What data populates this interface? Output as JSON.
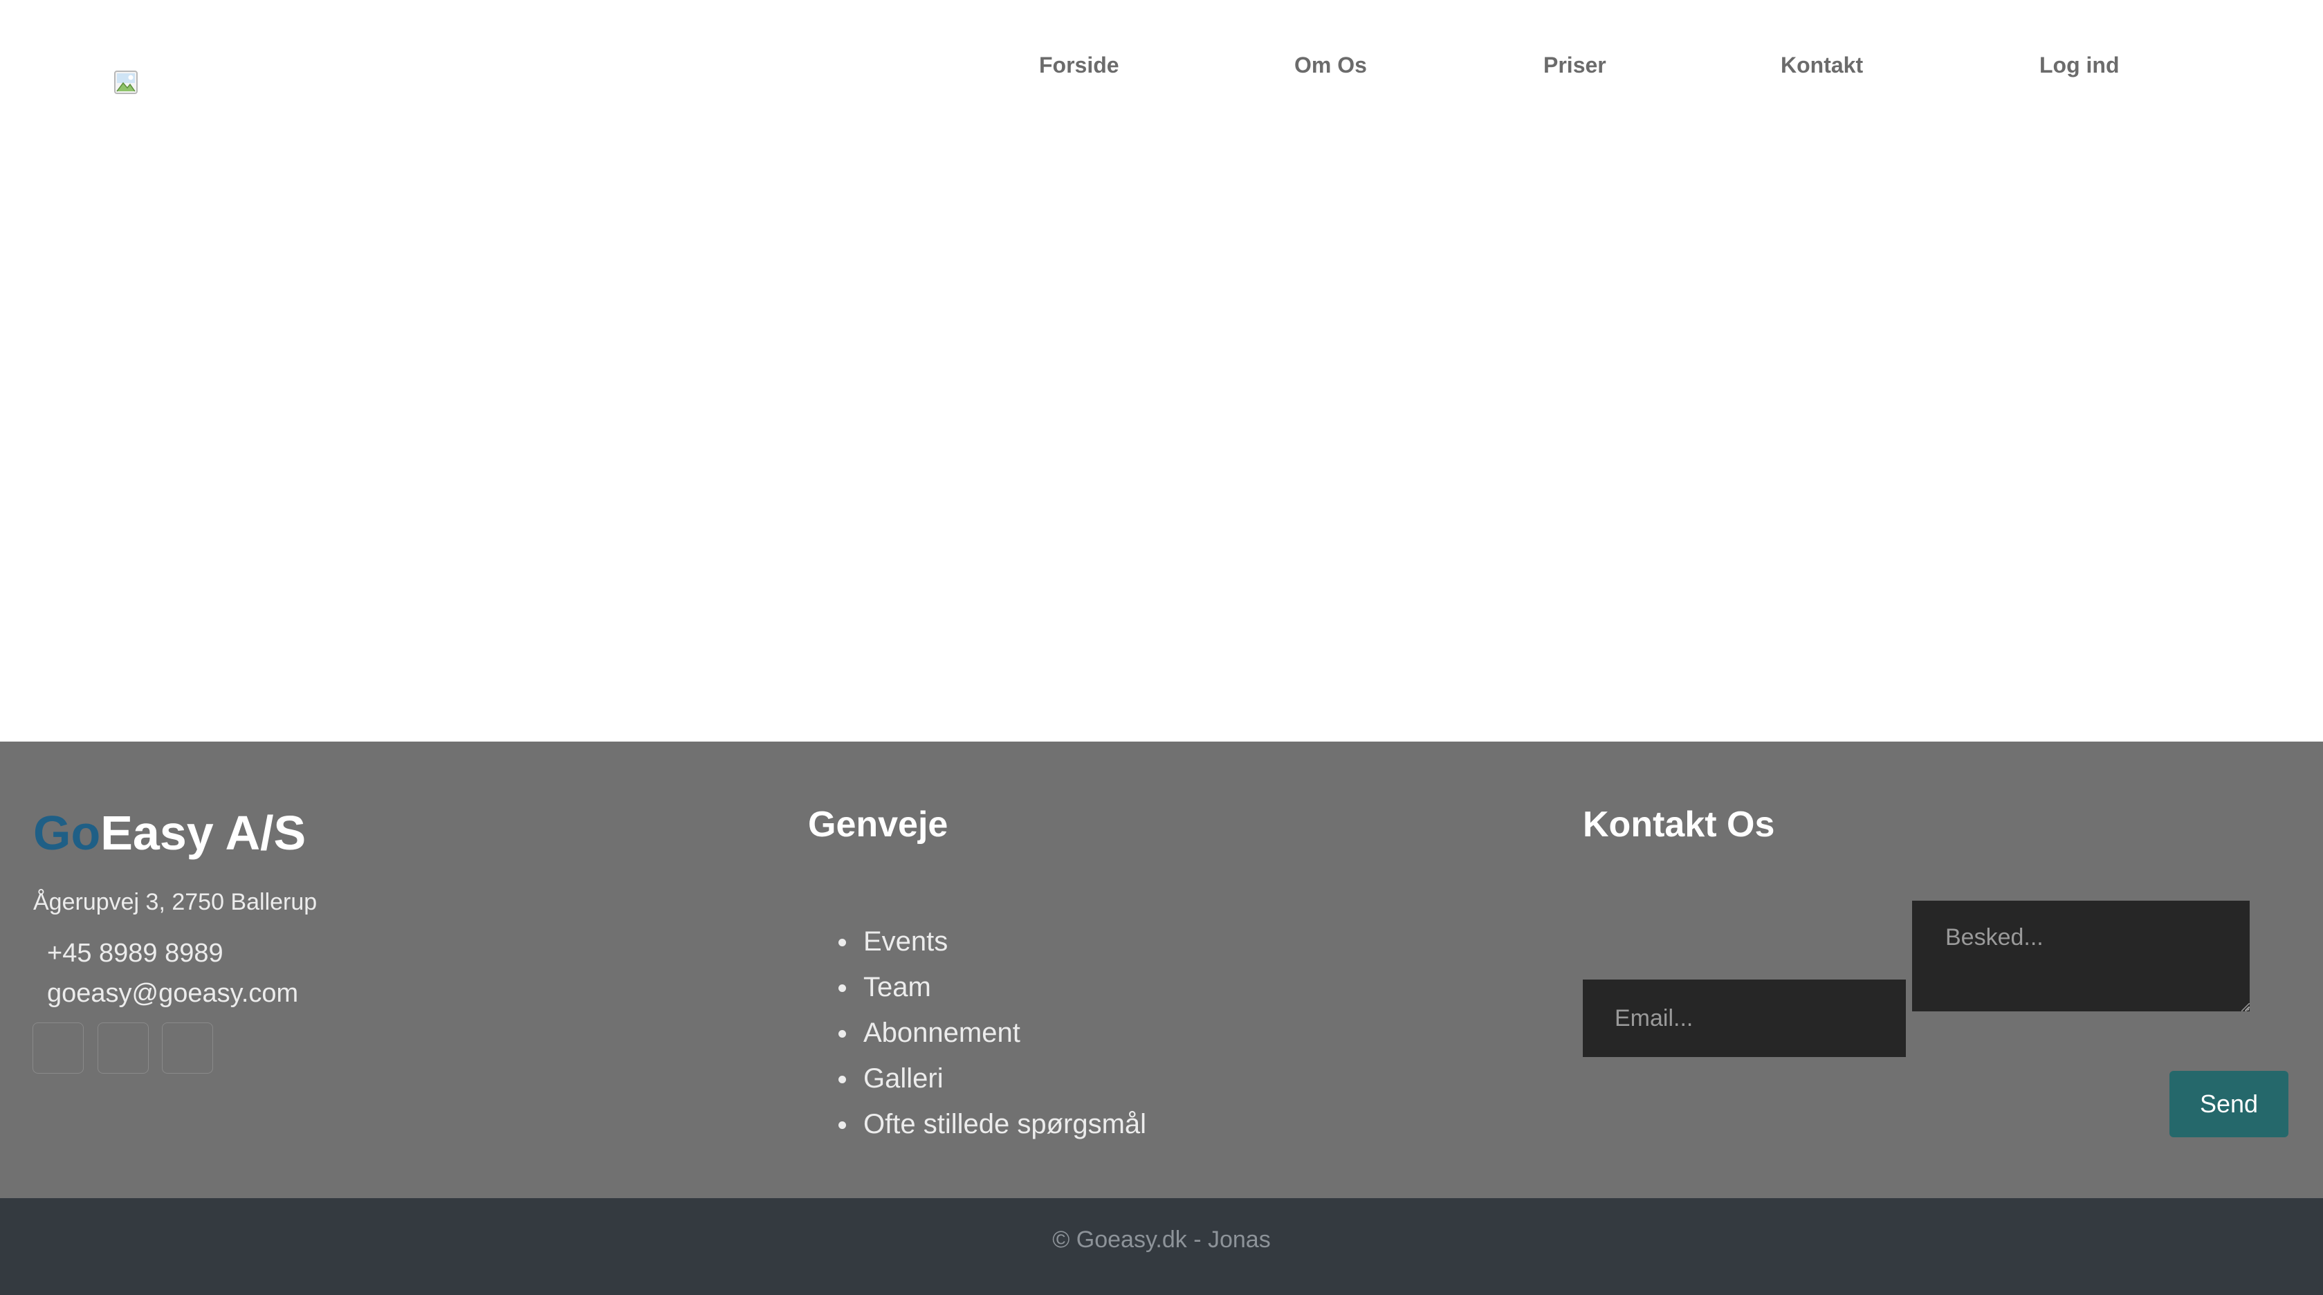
{
  "nav": {
    "items": [
      {
        "label": "Forside"
      },
      {
        "label": "Om Os"
      },
      {
        "label": "Priser"
      },
      {
        "label": "Kontakt"
      },
      {
        "label": "Log ind"
      }
    ]
  },
  "footer": {
    "brand": {
      "highlight": "Go",
      "rest": "Easy A/S",
      "highlight_color": "#1f5f86"
    },
    "address": "Ågerupvej 3, 2750 Ballerup",
    "phone": "+45 8989 8989",
    "email": "goeasy@goeasy.com",
    "shortcuts": {
      "title": "Genveje",
      "links": [
        {
          "label": "Events"
        },
        {
          "label": "Team"
        },
        {
          "label": "Abonnement"
        },
        {
          "label": "Galleri"
        },
        {
          "label": "Ofte stillede spørgsmål"
        }
      ]
    },
    "contact": {
      "title": "Kontakt Os",
      "email_placeholder": "Email...",
      "message_placeholder": "Besked...",
      "send_label": "Send",
      "send_color": "#25686b"
    }
  },
  "copyright": "© Goeasy.dk - Jonas"
}
